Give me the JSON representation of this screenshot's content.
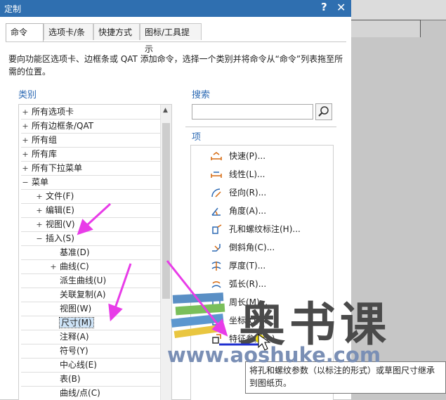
{
  "window": {
    "title": "定制",
    "help": "?",
    "close": "✕"
  },
  "tabs": [
    {
      "label": "命令",
      "active": true
    },
    {
      "label": "选项卡/条",
      "active": false
    },
    {
      "label": "快捷方式",
      "active": false
    },
    {
      "label": "图标/工具提示",
      "active": false
    }
  ],
  "description": "要向功能区选项卡、边框条或 QAT 添加命令，选择一个类别并将命令从“命令”列表拖至所需的位置。",
  "categories": {
    "heading": "类别",
    "rows": [
      {
        "label": "所有选项卡",
        "toggle": "+",
        "level": 0
      },
      {
        "label": "所有边框条/QAT",
        "toggle": "+",
        "level": 0
      },
      {
        "label": "所有组",
        "toggle": "+",
        "level": 0
      },
      {
        "label": "所有库",
        "toggle": "+",
        "level": 0
      },
      {
        "label": "所有下拉菜单",
        "toggle": "+",
        "level": 0
      },
      {
        "label": "菜单",
        "toggle": "−",
        "level": 0
      },
      {
        "label": "文件(F)",
        "toggle": "+",
        "level": 1
      },
      {
        "label": "编辑(E)",
        "toggle": "+",
        "level": 1
      },
      {
        "label": "视图(V)",
        "toggle": "+",
        "level": 1
      },
      {
        "label": "插入(S)",
        "toggle": "−",
        "level": 1
      },
      {
        "label": "基准(D)",
        "toggle": "",
        "level": 2
      },
      {
        "label": "曲线(C)",
        "toggle": "+",
        "level": 2
      },
      {
        "label": "派生曲线(U)",
        "toggle": "",
        "level": 2
      },
      {
        "label": "关联复制(A)",
        "toggle": "",
        "level": 2
      },
      {
        "label": "视图(W)",
        "toggle": "",
        "level": 2
      },
      {
        "label": "尺寸(M)",
        "toggle": "",
        "level": 2,
        "selected": true
      },
      {
        "label": "注释(A)",
        "toggle": "",
        "level": 2
      },
      {
        "label": "符号(Y)",
        "toggle": "",
        "level": 2
      },
      {
        "label": "中心线(E)",
        "toggle": "",
        "level": 2
      },
      {
        "label": "表(B)",
        "toggle": "",
        "level": 2
      },
      {
        "label": "曲线/点(C)",
        "toggle": "",
        "level": 2
      }
    ]
  },
  "search": {
    "heading": "搜索",
    "value": "",
    "placeholder": ""
  },
  "items": {
    "heading": "项",
    "list": [
      {
        "label": "快速(P)...",
        "icon": "rapid-dimension-icon"
      },
      {
        "label": "线性(L)...",
        "icon": "linear-dimension-icon"
      },
      {
        "label": "径向(R)...",
        "icon": "radial-dimension-icon"
      },
      {
        "label": "角度(A)...",
        "icon": "angular-dimension-icon"
      },
      {
        "label": "孔和螺纹标注(H)...",
        "icon": "hole-thread-callout-icon"
      },
      {
        "label": "倒斜角(C)...",
        "icon": "chamfer-dimension-icon"
      },
      {
        "label": "厚度(T)...",
        "icon": "thickness-dimension-icon"
      },
      {
        "label": "弧长(R)...",
        "icon": "arc-length-icon"
      },
      {
        "label": "周长(M)...",
        "icon": "perimeter-dimension-icon"
      },
      {
        "label": "坐标(O)...",
        "icon": "ordinate-dimension-icon"
      },
      {
        "label": "特征参数(A)...",
        "icon": "feature-parameters-icon"
      }
    ]
  },
  "tooltip": "将孔和螺纹参数（以标注的形式）或草图尺寸继承到图纸页。",
  "watermark": {
    "text": "奥书课",
    "url": "www.aoshuke.com"
  },
  "colors": {
    "titlebar": "#2f6fb0",
    "accent": "#2d6ab4",
    "arrow": "#e83ce8",
    "selection": "#cde3f7"
  }
}
